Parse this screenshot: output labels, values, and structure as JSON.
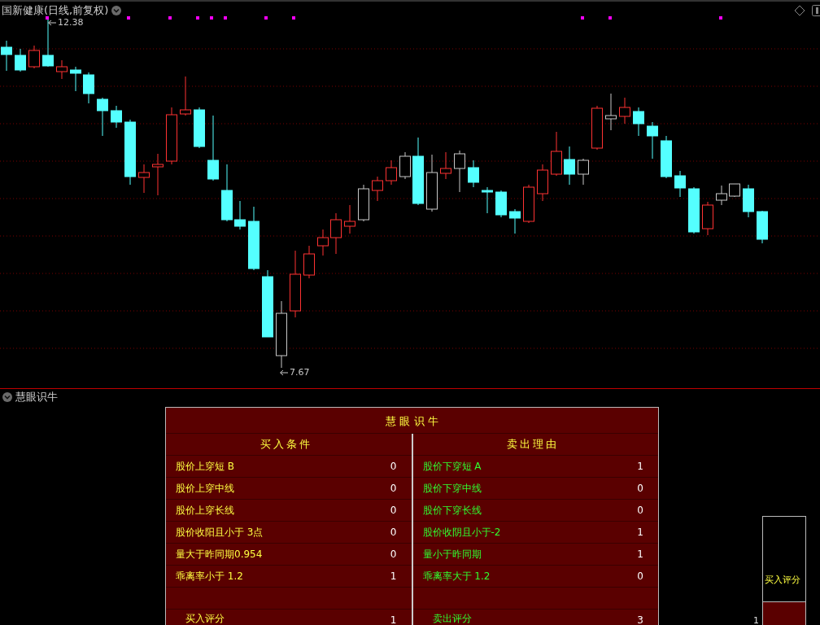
{
  "chart": {
    "title": "国新健康(日线,前复权)",
    "high_label": "12.38",
    "low_label": "7.67"
  },
  "indicator": {
    "title": "慧眼识牛",
    "table": {
      "title": "慧 眼 识 牛",
      "columns": [
        {
          "kind": "buy",
          "heading": "买入条件",
          "rows": [
            {
              "label": "股价上穿短 B",
              "value": "0"
            },
            {
              "label": "股价上穿中线",
              "value": "0"
            },
            {
              "label": "股价上穿长线",
              "value": "0"
            },
            {
              "label": "股价收阳且小于 3点",
              "value": "0"
            },
            {
              "label": "量大于昨同期0.954",
              "value": "0"
            },
            {
              "label": "乖离率小于 1.2",
              "value": "1"
            }
          ],
          "score_label": "买入评分",
          "score": "1"
        },
        {
          "kind": "sell",
          "heading": "卖出理由",
          "rows": [
            {
              "label": "股价下穿短 A",
              "value": "1"
            },
            {
              "label": "股价下穿中线",
              "value": "0"
            },
            {
              "label": "股价下穿长线",
              "value": "0"
            },
            {
              "label": "股价收阴且小于-2",
              "value": "1"
            },
            {
              "label": "量小于昨同期",
              "value": "1"
            },
            {
              "label": "乖离率大于 1.2",
              "value": "0"
            }
          ],
          "score_label": "卖出评分",
          "score": "3"
        }
      ]
    },
    "score_meter": {
      "label": "买入评分",
      "value": "1",
      "level": 0.22
    }
  }
}
